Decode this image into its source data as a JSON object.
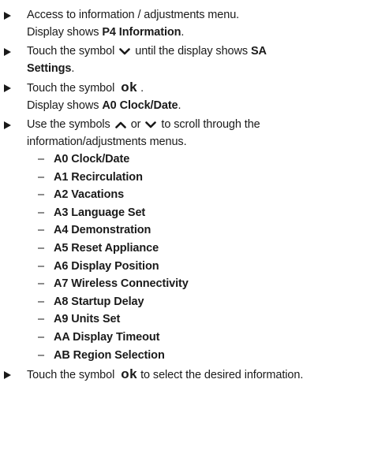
{
  "steps": [
    {
      "line1": "Access to information / adjustments menu.",
      "line2_prefix": "Display shows ",
      "line2_bold": "P4 Information",
      "line2_suffix": "."
    },
    {
      "prefix": "Touch the symbol",
      "symbol_icon": "chevron-down-icon",
      "middle": "until the display shows ",
      "bold_a": "SA",
      "bold_b": "Settings",
      "suffix": "."
    },
    {
      "prefix": "Touch the symbol",
      "ok_symbol": "ok",
      "suffix": ".",
      "line2_prefix": "Display shows ",
      "line2_bold": "A0 Clock/Date",
      "line2_suffix": "."
    },
    {
      "prefix": "Use the symbols",
      "symbol_up_icon": "chevron-up-icon",
      "or_text": "or",
      "symbol_down_icon": "chevron-down-icon",
      "middle": "to scroll through the",
      "line2": "information/adjustments menus."
    },
    {
      "prefix": "Touch the symbol",
      "ok_symbol": "ok",
      "suffix": "to select the desired information."
    }
  ],
  "menu_dash": "–",
  "menus": [
    "A0 Clock/Date",
    "A1 Recirculation",
    "A2 Vacations",
    "A3 Language Set",
    "A4 Demonstration",
    "A5 Reset Appliance",
    "A6 Display Position",
    "A7 Wireless Connectivity",
    "A8 Startup Delay",
    "A9 Units Set",
    "AA Display Timeout",
    "AB Region Selection"
  ]
}
